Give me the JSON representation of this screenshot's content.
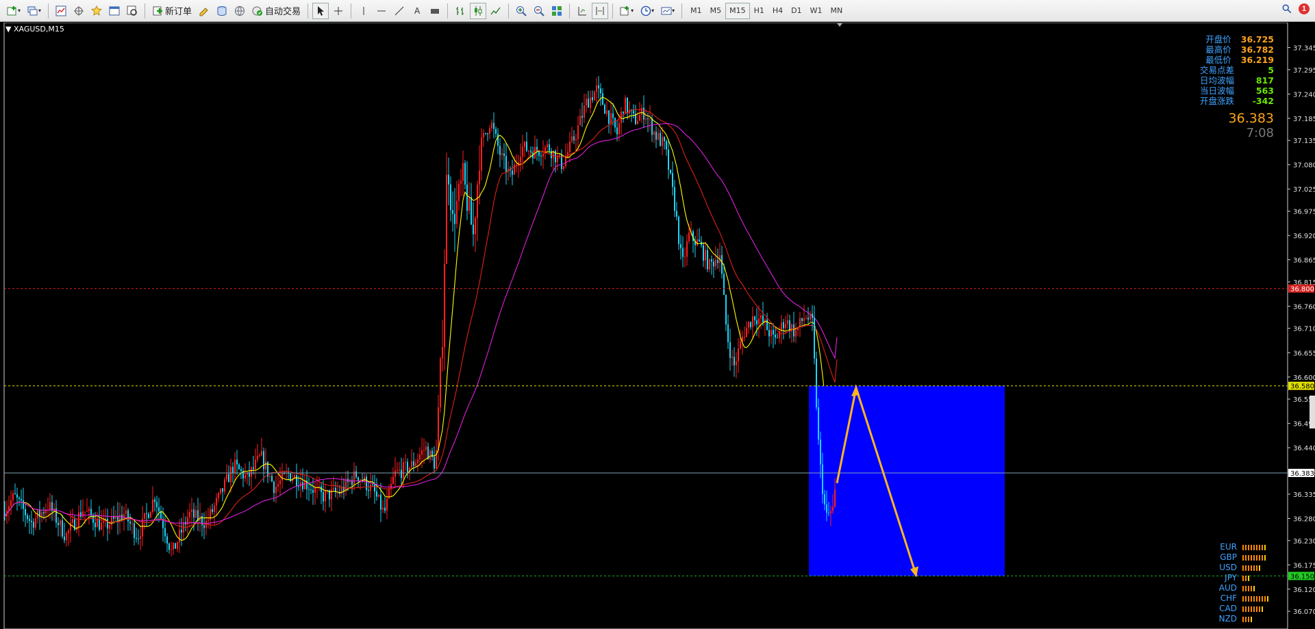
{
  "toolbar": {
    "new_order_label": "新订单",
    "auto_trade_label": "自动交易",
    "timeframes": [
      "M1",
      "M5",
      "M15",
      "H1",
      "H4",
      "D1",
      "W1",
      "MN"
    ],
    "active_timeframe": "M15",
    "notification_count": "1"
  },
  "chart": {
    "symbol_label": "XAGUSD,M15",
    "current_price": "36.383",
    "countdown": "7:08",
    "price_axis_labels": [
      "37.345",
      "37.295",
      "37.240",
      "37.185",
      "37.135",
      "37.080",
      "37.025",
      "36.975",
      "36.920",
      "36.865",
      "36.815",
      "36.760",
      "36.710",
      "36.655",
      "36.600",
      "36.550",
      "36.495",
      "36.440",
      "36.385",
      "36.335",
      "36.280",
      "36.230",
      "36.175",
      "36.120",
      "36.070"
    ],
    "level_tags": {
      "resistance": "36.800",
      "support_high": "36.580",
      "current": "36.383",
      "support_low": "36.150"
    },
    "colors": {
      "bull": "#ff2020",
      "bear": "#21d4f5",
      "ma_fast": "#ffff00",
      "ma_mid": "#e0201a",
      "ma_slow": "#e020e0",
      "zone": "#0000ff",
      "arrow": "#ffb520"
    }
  },
  "info_panel": {
    "rows": [
      {
        "label": "开盘价",
        "value": "36.725"
      },
      {
        "label": "最高价",
        "value": "36.782"
      },
      {
        "label": "最低价",
        "value": "36.219"
      },
      {
        "label": "交易点差",
        "value": "5"
      },
      {
        "label": "日均波幅",
        "value": "817"
      },
      {
        "label": "当日波幅",
        "value": "563"
      },
      {
        "label": "开盘涨跌",
        "value": "-342"
      }
    ]
  },
  "currency_strength": [
    {
      "name": "EUR",
      "level": 9
    },
    {
      "name": "GBP",
      "level": 9
    },
    {
      "name": "USD",
      "level": 7
    },
    {
      "name": "JPY",
      "level": 3
    },
    {
      "name": "AUD",
      "level": 5
    },
    {
      "name": "CHF",
      "level": 10
    },
    {
      "name": "CAD",
      "level": 8
    },
    {
      "name": "NZD",
      "level": 4
    }
  ]
}
